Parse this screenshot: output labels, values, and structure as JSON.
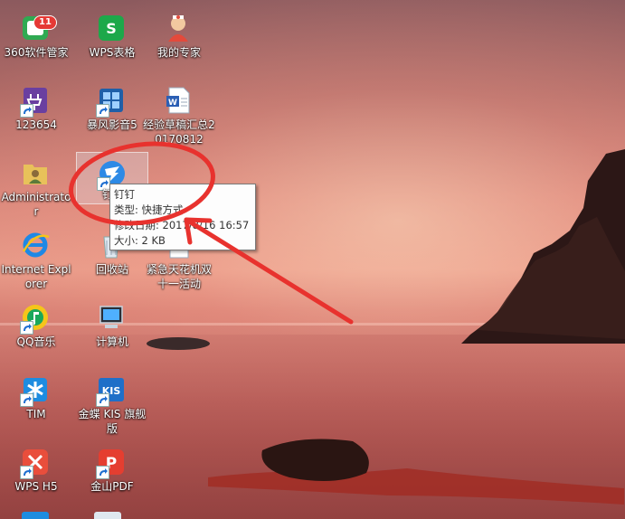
{
  "desktop": {
    "icons": [
      {
        "id": "360",
        "label": "360软件管家",
        "badge": "11"
      },
      {
        "id": "wps-sheets",
        "label": "WPS表格"
      },
      {
        "id": "my-expert",
        "label": "我的专家"
      },
      {
        "id": "123654",
        "label": "123654"
      },
      {
        "id": "storm",
        "label": "暴风影音5"
      },
      {
        "id": "draft-summary",
        "label": "经验草稿汇总20170812"
      },
      {
        "id": "admin",
        "label": "Administrator"
      },
      {
        "id": "dingtalk",
        "label": "钉钉"
      },
      {
        "id": "ie",
        "label": "Internet Explorer"
      },
      {
        "id": "recycle",
        "label": "回收站"
      },
      {
        "id": "urgent-plan",
        "label": "紧急天花机双十一活动"
      },
      {
        "id": "qqmusic",
        "label": "QQ音乐"
      },
      {
        "id": "computer",
        "label": "计算机"
      },
      {
        "id": "tim",
        "label": "TIM"
      },
      {
        "id": "kis",
        "label": "金蝶 KIS 旗舰版"
      },
      {
        "id": "wps-h5",
        "label": "WPS H5"
      },
      {
        "id": "pdf",
        "label": "金山PDF"
      }
    ]
  },
  "tooltip": {
    "title": "钉钉",
    "type_line": "类型: 快捷方式",
    "date_line": "修改日期: 2017/8/16 16:57",
    "size_line": "大小: 2 KB"
  },
  "colors": {
    "annotation_red": "#e8322e",
    "selection": "#dcdce6"
  }
}
